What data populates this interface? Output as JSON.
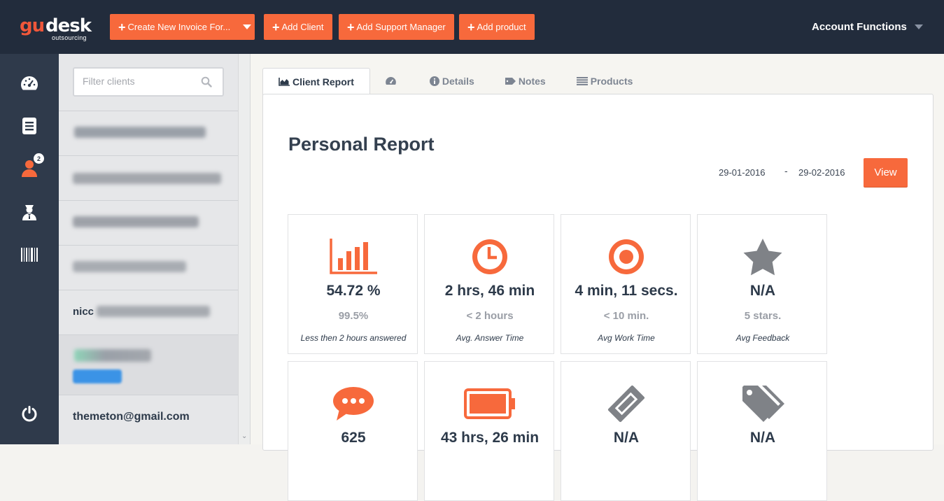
{
  "app": {
    "logo_left": "gu",
    "logo_right": "desk",
    "logo_sub": "outsourcing"
  },
  "topbar": {
    "buttons": [
      {
        "label": "Create New Invoice For...",
        "has_caret": true
      },
      {
        "label": "Add Client"
      },
      {
        "label": "Add Support Manager"
      },
      {
        "label": "Add product"
      }
    ],
    "account_label": "Account Functions"
  },
  "sidebar": {
    "items": [
      {
        "icon": "dashboard-icon"
      },
      {
        "icon": "document-icon"
      },
      {
        "icon": "users-icon",
        "badge": "2"
      },
      {
        "icon": "support-agent-icon"
      },
      {
        "icon": "barcode-icon"
      }
    ],
    "bottom_icon": "power-icon"
  },
  "clients": {
    "filter_placeholder": "Filter clients",
    "visible_email": "themeton@gmail.com",
    "partial_prefix": "nicc"
  },
  "tabs": [
    {
      "label": "Client Report",
      "icon": "area-chart-icon",
      "active": true
    },
    {
      "label": "",
      "icon": "dashboard-icon"
    },
    {
      "label": "Details",
      "icon": "info-icon"
    },
    {
      "label": "Notes",
      "icon": "tag-icon"
    },
    {
      "label": "Products",
      "icon": "list-icon"
    }
  ],
  "report": {
    "title": "Personal Report",
    "date_from": "29-01-2016",
    "date_sep": "-",
    "date_to": "29-02-2016",
    "view_label": "View",
    "cards": [
      {
        "icon": "bar-chart-icon",
        "value": "54.72 %",
        "target": "99.5%",
        "label": "Less then 2 hours answered"
      },
      {
        "icon": "clock-icon",
        "value": "2 hrs, 46 min",
        "target": "< 2 hours",
        "label": "Avg. Answer Time"
      },
      {
        "icon": "target-icon",
        "value": "4 min, 11 secs.",
        "target": "< 10 min.",
        "label": "Avg Work Time"
      },
      {
        "icon": "star-icon",
        "value": "N/A",
        "target": "5 stars.",
        "label": "Avg Feedback"
      },
      {
        "icon": "chat-icon",
        "value": "625",
        "target": "",
        "label": ""
      },
      {
        "icon": "battery-icon",
        "value": "43 hrs, 26 min",
        "target": "",
        "label": ""
      },
      {
        "icon": "ticket-icon",
        "value": "N/A",
        "target": "",
        "label": ""
      },
      {
        "icon": "tags-icon",
        "value": "N/A",
        "target": "",
        "label": ""
      }
    ]
  },
  "colors": {
    "accent": "#f7693c",
    "topbar": "#222c3c",
    "sidebar": "#2f3a4b"
  }
}
